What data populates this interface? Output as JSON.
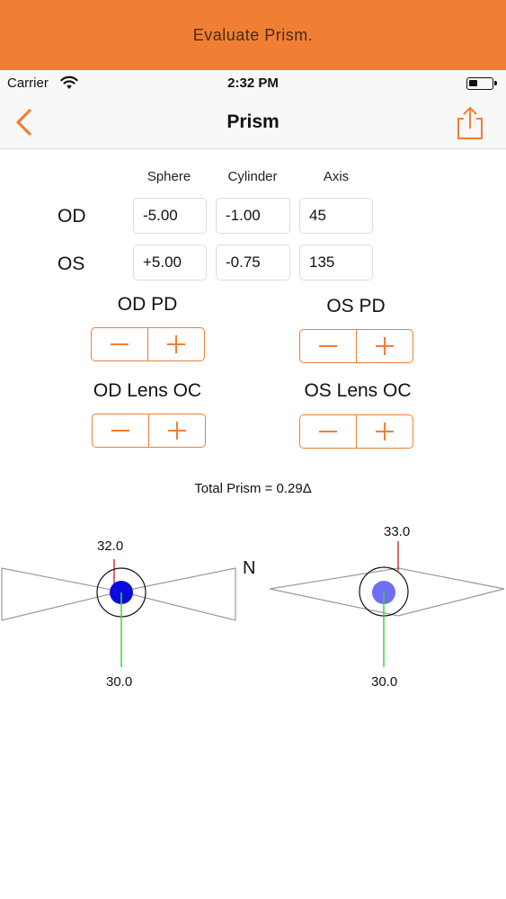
{
  "banner": {
    "title": "Evaluate Prism."
  },
  "status_bar": {
    "carrier": "Carrier",
    "time": "2:32 PM",
    "battery_level": 0.4
  },
  "nav": {
    "title": "Prism",
    "back_icon": "chevron-left-icon",
    "share_icon": "share-icon"
  },
  "table": {
    "columns": [
      "Sphere",
      "Cylinder",
      "Axis"
    ],
    "rows": [
      {
        "label": "OD",
        "sphere": "-5.00",
        "cylinder": "-1.00",
        "axis": "45"
      },
      {
        "label": "OS",
        "sphere": "+5.00",
        "cylinder": "-0.75",
        "axis": "135"
      }
    ]
  },
  "controls": {
    "od_pd": "OD PD",
    "os_pd": "OS PD",
    "od_lens_oc": "OD Lens OC",
    "os_lens_oc": "OS Lens OC",
    "minus_icon": "minus-icon",
    "plus_icon": "plus-icon"
  },
  "total_prism": "Total Prism = 0.29Δ",
  "diagram": {
    "nasal_label": "N",
    "od": {
      "top_value": "32.0",
      "bottom_value": "30.0"
    },
    "os": {
      "top_value": "33.0",
      "bottom_value": "30.0"
    }
  },
  "colors": {
    "accent": "#f07f33",
    "od_pupil": "#0b0bdb",
    "os_pupil": "#6e6ef2",
    "vertical_up": "#d43a3a",
    "vertical_down": "#3fd43f",
    "lens_outline": "#9a9a9a"
  }
}
